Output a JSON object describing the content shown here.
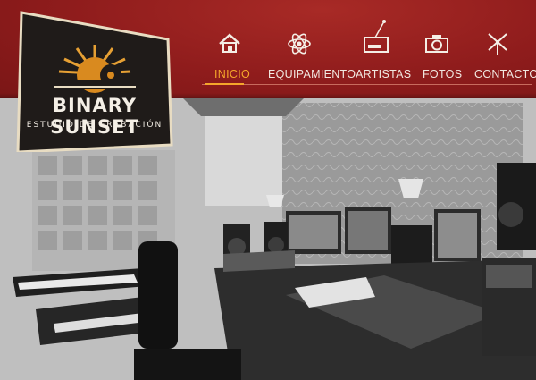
{
  "brand": {
    "name": "BINARY SUNSET",
    "tagline": "ESTUDIO DE GRABACIÓN",
    "colors": {
      "header": "#8f1c1c",
      "accent": "#f5a62b",
      "logo_plate": "#201c1a",
      "logo_border": "#e8dcc2"
    }
  },
  "nav": {
    "items": [
      {
        "label": "INICIO",
        "icon": "house-icon",
        "active": true
      },
      {
        "label": "EQUIPAMIENTO",
        "icon": "atom-icon",
        "active": false
      },
      {
        "label": "ARTISTAS",
        "icon": "radio-icon",
        "active": false
      },
      {
        "label": "FOTOS",
        "icon": "camera-icon",
        "active": false
      },
      {
        "label": "CONTACTO",
        "icon": "windmill-icon",
        "active": false
      }
    ]
  },
  "hero": {
    "image": "recording-studio-photo"
  }
}
